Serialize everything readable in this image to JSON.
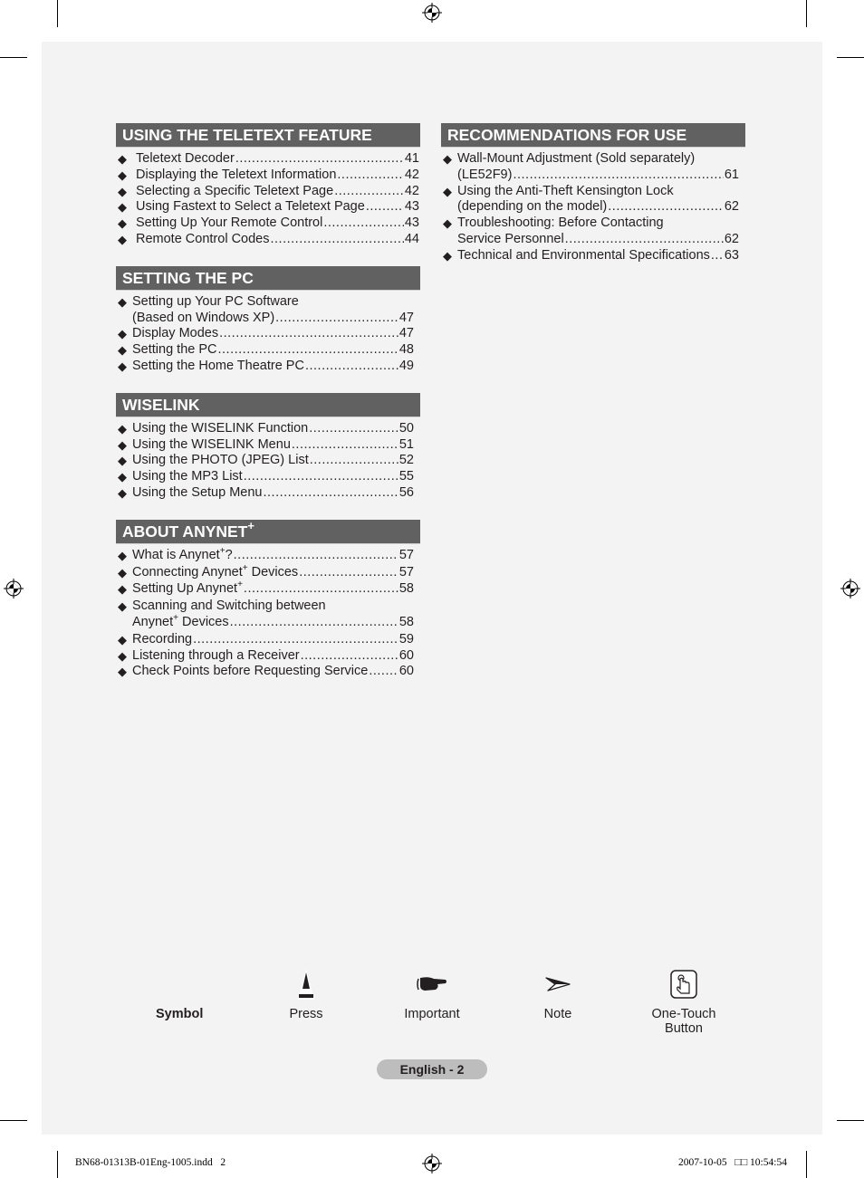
{
  "sections_left": [
    {
      "title": "USING THE TELETEXT FEATURE",
      "title_sup": "",
      "items": [
        {
          "text": "Teletext Decoder",
          "page": "41"
        },
        {
          "text": "Displaying the Teletext Information",
          "page": "42"
        },
        {
          "text": "Selecting a Specific Teletext Page",
          "page": "42"
        },
        {
          "text": "Using Fastext to Select a Teletext Page",
          "page": "43"
        },
        {
          "text": "Setting Up Your Remote Control",
          "page": "43"
        },
        {
          "text": "Remote Control Codes",
          "page": "44"
        }
      ]
    },
    {
      "title": "SETTING THE PC",
      "title_sup": "",
      "items": [
        {
          "text_line1": "Setting up Your PC Software",
          "text": "(Based on Windows XP)",
          "page": "47"
        },
        {
          "text": "Display Modes",
          "page": "47"
        },
        {
          "text": "Setting the PC",
          "page": "48"
        },
        {
          "text": "Setting the Home Theatre PC",
          "page": "49"
        }
      ]
    },
    {
      "title": "WISELINK",
      "title_sup": "",
      "items": [
        {
          "text": "Using the WISELINK Function",
          "page": "50"
        },
        {
          "text": "Using the WISELINK Menu",
          "page": "51"
        },
        {
          "text": "Using the PHOTO (JPEG) List",
          "page": "52"
        },
        {
          "text": "Using the MP3 List",
          "page": "55"
        },
        {
          "text": "Using the Setup Menu",
          "page": "56"
        }
      ]
    },
    {
      "title": "ABOUT ANYNET",
      "title_sup": "+",
      "items": [
        {
          "text_pre": "What is Anynet",
          "sup": "+",
          "text_post": "?",
          "page": "57"
        },
        {
          "text_pre": "Connecting Anynet",
          "sup": "+",
          "text_post": " Devices",
          "page": "57"
        },
        {
          "text_pre": "Setting Up Anynet",
          "sup": "+",
          "text_post": "",
          "page": "58"
        },
        {
          "text_line1": "Scanning and Switching between",
          "text_pre": "Anynet",
          "sup": "+",
          "text_post": " Devices",
          "page": "58"
        },
        {
          "text": "Recording",
          "page": "59"
        },
        {
          "text": "Listening through a Receiver",
          "page": "60"
        },
        {
          "text": "Check Points before Requesting Service",
          "page": "60"
        }
      ]
    }
  ],
  "sections_right": [
    {
      "title": "RECOMMENDATIONS FOR USE",
      "items": [
        {
          "text_line1": "Wall-Mount Adjustment (Sold separately)",
          "text": "(LE52F9)",
          "page": "61"
        },
        {
          "text_line1": "Using the Anti-Theft Kensington Lock",
          "text": "(depending on the model)",
          "page": "62"
        },
        {
          "text_line1": "Troubleshooting: Before Contacting",
          "text": "Service Personnel",
          "page": "62"
        },
        {
          "text": "Technical and Environmental Specifications",
          "page": "63"
        }
      ]
    }
  ],
  "bullet_glyph": "◆",
  "symbols": {
    "title": "Symbol",
    "items": [
      {
        "icon": "press-icon",
        "label": "Press"
      },
      {
        "icon": "pointing-hand-icon",
        "label": "Important"
      },
      {
        "icon": "arrow-note-icon",
        "label": "Note"
      },
      {
        "icon": "one-touch-button-icon",
        "label_line1": "One-Touch",
        "label_line2": "Button"
      }
    ]
  },
  "footer": {
    "page_label": "English - 2",
    "slug_file": "BN68-01313B-01Eng-1005.indd   2",
    "slug_date": "2007-10-05   □□ 10:54:54"
  },
  "colors": {
    "header_bg": "#616161",
    "page_bg": "#f3f3f3",
    "pagenum_bg": "#bdbdbd"
  }
}
